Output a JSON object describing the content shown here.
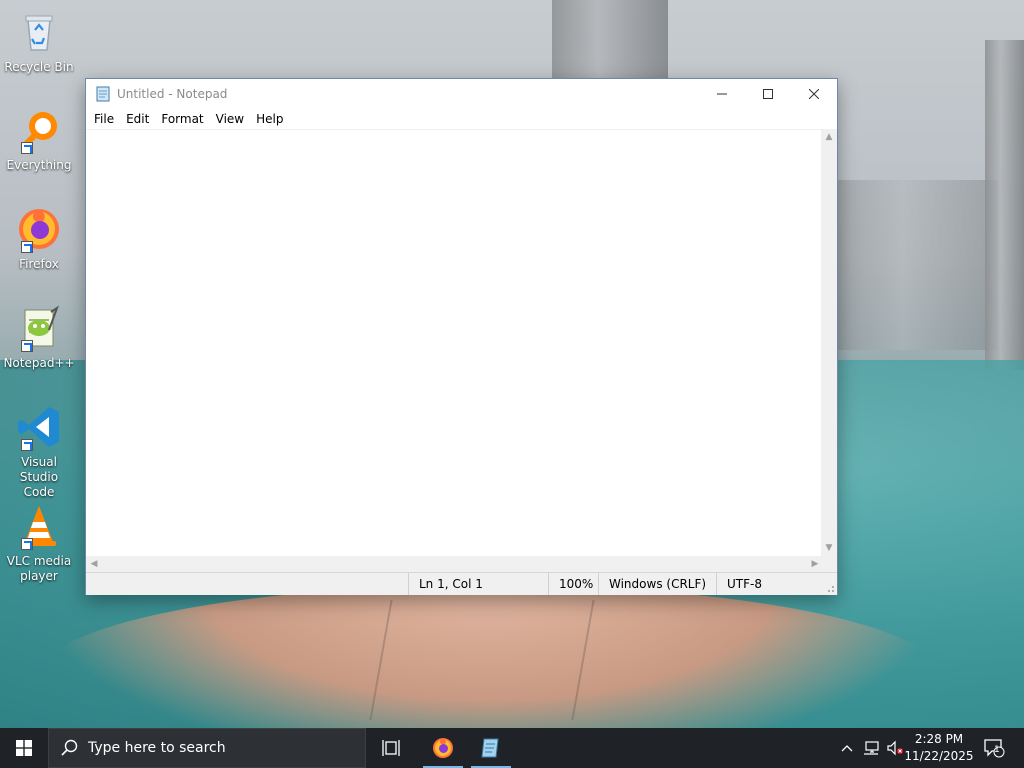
{
  "desktop": {
    "icons": [
      {
        "label": "Recycle Bin",
        "icon": "recycle-bin-icon"
      },
      {
        "label": "Everything",
        "icon": "everything-search-icon"
      },
      {
        "label": "Firefox",
        "icon": "firefox-icon"
      },
      {
        "label": "Notepad++",
        "icon": "notepad-plus-plus-icon"
      },
      {
        "label": "Visual Studio Code",
        "icon": "vscode-icon"
      },
      {
        "label": "VLC media player",
        "icon": "vlc-icon"
      }
    ]
  },
  "notepad": {
    "title": "Untitled - Notepad",
    "menu": [
      "File",
      "Edit",
      "Format",
      "View",
      "Help"
    ],
    "content": "",
    "status": {
      "position": "Ln 1, Col 1",
      "zoom": "100%",
      "line_ending": "Windows (CRLF)",
      "encoding": "UTF-8"
    }
  },
  "taskbar": {
    "search_placeholder": "Type here to search",
    "apps": [
      {
        "name": "task-view",
        "icon": "task-view-icon",
        "active": false
      },
      {
        "name": "firefox",
        "icon": "firefox-icon",
        "active": true
      },
      {
        "name": "notepad",
        "icon": "notepad-icon",
        "active": true
      }
    ],
    "clock": {
      "time": "2:28 PM",
      "date": "11/22/2025"
    },
    "notification_count": "1"
  },
  "colors": {
    "taskbar_bg": "#1f2328",
    "accent": "#76b9ed",
    "window_border": "#6e88a8"
  }
}
